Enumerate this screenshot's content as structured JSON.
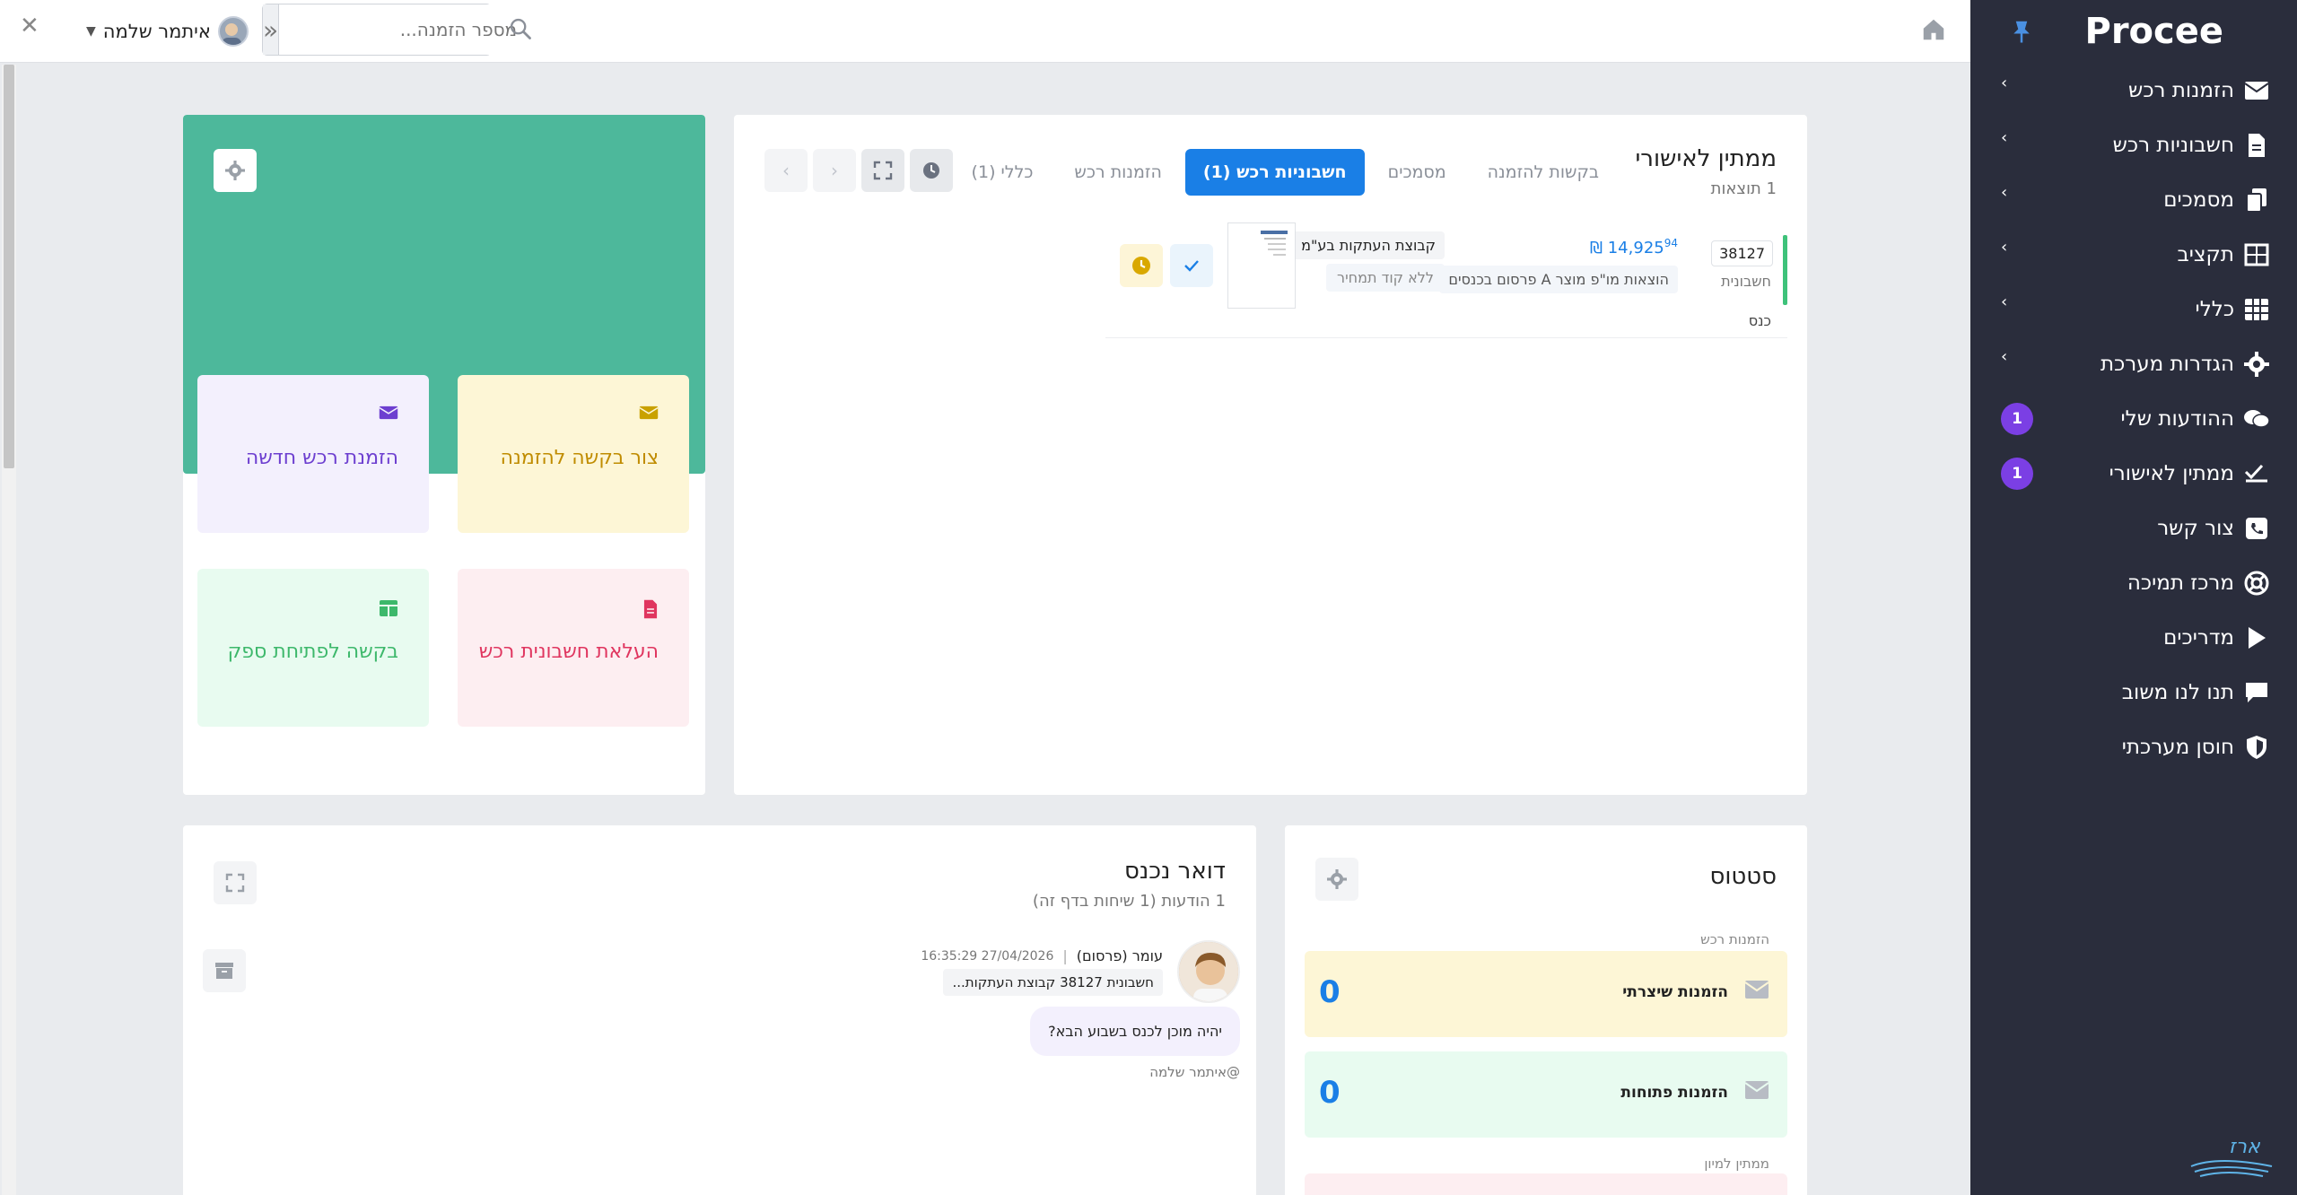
{
  "sidebar": {
    "logo": "Procee",
    "items": [
      {
        "label": "הזמנות רכש",
        "icon": "envelope-icon",
        "chevron": true
      },
      {
        "label": "חשבוניות רכש",
        "icon": "file-icon",
        "chevron": true
      },
      {
        "label": "מסמכים",
        "icon": "documents-icon",
        "chevron": true
      },
      {
        "label": "תקציב",
        "icon": "budget-icon",
        "chevron": true
      },
      {
        "label": "כללי",
        "icon": "table-icon",
        "chevron": true
      },
      {
        "label": "הגדרות מערכת",
        "icon": "gear-icon",
        "chevron": true
      },
      {
        "label": "ההודעות שלי",
        "icon": "chat-icon",
        "badge": "1"
      },
      {
        "label": "ממתין לאישורי",
        "icon": "double-check-icon",
        "badge": "1"
      },
      {
        "label": "צור קשר",
        "icon": "phone-icon"
      },
      {
        "label": "מרכז תמיכה",
        "icon": "lifebuoy-icon"
      },
      {
        "label": "מדריכים",
        "icon": "play-icon"
      },
      {
        "label": "תנו לנו משוב",
        "icon": "comment-icon"
      },
      {
        "label": "חוסן מערכתי",
        "icon": "shield-icon"
      }
    ],
    "bottom_brand": "ארז"
  },
  "topbar": {
    "user_name": "איתמר שלמה",
    "search_placeholder": "מספר הזמנה..."
  },
  "pending": {
    "title": "ממתין לאישורי",
    "results": "1 תוצאות",
    "tabs": [
      {
        "label": "כללי (1)",
        "active": false
      },
      {
        "label": "הזמנות רכש",
        "active": false
      },
      {
        "label": "חשבוניות רכש (1)",
        "active": true
      },
      {
        "label": "מסמכים",
        "active": false
      },
      {
        "label": "בקשות להזמנה",
        "active": false
      }
    ],
    "row": {
      "number": "38127",
      "doc_type": "חשבונית",
      "amount": "14,925",
      "amount_cents": "94",
      "currency": "₪",
      "description": "הוצאות מו\"פ מוצר A פרסום בכנסים",
      "supplier": "קבוצת העתקות בע\"מ",
      "no_price_code": "ללא קוד תמחיר",
      "direction": "כנס"
    }
  },
  "quick_actions": {
    "tiles": [
      {
        "label": "הזמנת רכש חדשה",
        "icon": "envelope-icon"
      },
      {
        "label": "צור בקשה להזמנה",
        "icon": "envelope-icon"
      },
      {
        "label": "בקשה לפתיחת ספק",
        "icon": "grid-icon"
      },
      {
        "label": "העלאת חשבונית רכש",
        "icon": "file-icon"
      }
    ]
  },
  "status": {
    "title": "סטטוס",
    "section_orders": "הזמנות רכש",
    "cards": [
      {
        "label": "הזמנות שיצרתי",
        "value": "0"
      },
      {
        "label": "הזמנות פתוחות",
        "value": "0"
      }
    ],
    "section_pending_sort": "ממתין למיון"
  },
  "inbox": {
    "title": "דואר נכנס",
    "subtitle": "1 הודעות (1 שיחות בדף זה)",
    "message": {
      "sender": "עומר (פרסום)",
      "sep": "|",
      "time": "27/04/2026 16:35:29",
      "ref": "חשבונית 38127 קבוצת העתקות...",
      "body": "יהיה מוכן לכנס בשבוע הבא?",
      "mention": "@איתמר שלמה"
    }
  }
}
